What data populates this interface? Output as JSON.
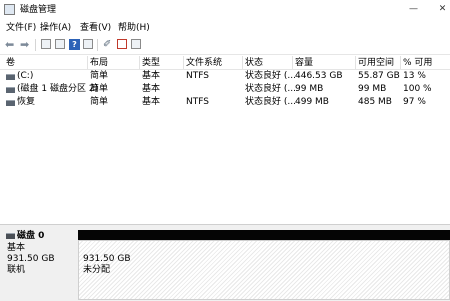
{
  "window": {
    "title": "磁盘管理",
    "controls": {
      "minimize": "—",
      "close": "✕"
    }
  },
  "menu": [
    {
      "label": "文件(F)"
    },
    {
      "label": "操作(A)"
    },
    {
      "label": "查看(V)"
    },
    {
      "label": "帮助(H)"
    }
  ],
  "toolbar": {
    "back_icon": "back-arrow",
    "forward_icon": "forward-arrow",
    "help_glyph": "?"
  },
  "table": {
    "columns": [
      "卷",
      "布局",
      "类型",
      "文件系统",
      "状态",
      "容量",
      "可用空间",
      "% 可用"
    ],
    "rows": [
      {
        "volume": "(C:)",
        "layout": "简单",
        "type": "基本",
        "fs": "NTFS",
        "status": "状态良好 (...",
        "capacity": "446.53 GB",
        "free": "55.87 GB",
        "pct": "13 %"
      },
      {
        "volume": "(磁盘 1 磁盘分区 2)",
        "layout": "简单",
        "type": "基本",
        "fs": "",
        "status": "状态良好 (...",
        "capacity": "99 MB",
        "free": "99 MB",
        "pct": "100 %"
      },
      {
        "volume": "恢复",
        "layout": "简单",
        "type": "基本",
        "fs": "NTFS",
        "status": "状态良好 (...",
        "capacity": "499 MB",
        "free": "485 MB",
        "pct": "97 %"
      }
    ]
  },
  "disk": {
    "name": "磁盘 0",
    "kind": "基本",
    "size": "931.50 GB",
    "state": "联机",
    "partition_size": "931.50 GB",
    "partition_label": "未分配"
  }
}
